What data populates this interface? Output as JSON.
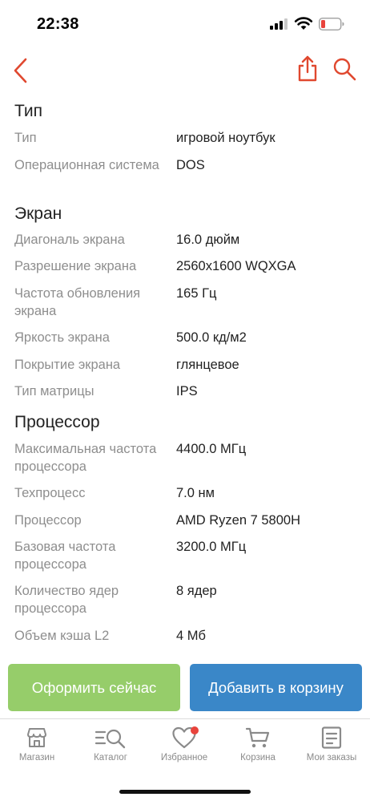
{
  "status_bar": {
    "time": "22:38"
  },
  "specs": {
    "sections": [
      {
        "title": "Тип",
        "rows": [
          {
            "label": "Тип",
            "value": "игровой ноутбук"
          },
          {
            "label": "Операционная система",
            "value": "DOS"
          }
        ]
      },
      {
        "title": "Экран",
        "rows": [
          {
            "label": "Диагональ экрана",
            "value": "16.0 дюйм"
          },
          {
            "label": "Разрешение экрана",
            "value": "2560x1600 WQXGA"
          },
          {
            "label": "Частота обновления экрана",
            "value": "165 Гц"
          },
          {
            "label": "Яркость экрана",
            "value": "500.0 кд/м2"
          },
          {
            "label": "Покрытие экрана",
            "value": "глянцевое"
          },
          {
            "label": "Тип матрицы",
            "value": "IPS"
          }
        ]
      },
      {
        "title": "Процессор",
        "rows": [
          {
            "label": "Максимальная частота процессора",
            "value": "4400.0 МГц"
          },
          {
            "label": "Техпроцесс",
            "value": "7.0 нм"
          },
          {
            "label": "Процессор",
            "value": "AMD Ryzen 7 5800H"
          },
          {
            "label": "Базовая частота процессора",
            "value": "3200.0 МГц"
          },
          {
            "label": "Количество ядер процессора",
            "value": "8 ядер"
          },
          {
            "label": "Объем кэша L2",
            "value": "4 Мб"
          }
        ]
      }
    ]
  },
  "actions": {
    "checkout_label": "Оформить сейчас",
    "add_to_cart_label": "Добавить в корзину"
  },
  "tab_bar": {
    "items": [
      {
        "label": "Магазин",
        "icon": "store-icon"
      },
      {
        "label": "Каталог",
        "icon": "catalog-search-icon"
      },
      {
        "label": "Избранное",
        "icon": "heart-icon"
      },
      {
        "label": "Корзина",
        "icon": "cart-icon"
      },
      {
        "label": "Мои заказы",
        "icon": "orders-icon"
      }
    ]
  },
  "colors": {
    "accent": "#e0482f",
    "checkout_button": "#96cd6a",
    "cart_button": "#3a87c8",
    "badge": "#e8433c",
    "battery_low": "#e8433c"
  }
}
